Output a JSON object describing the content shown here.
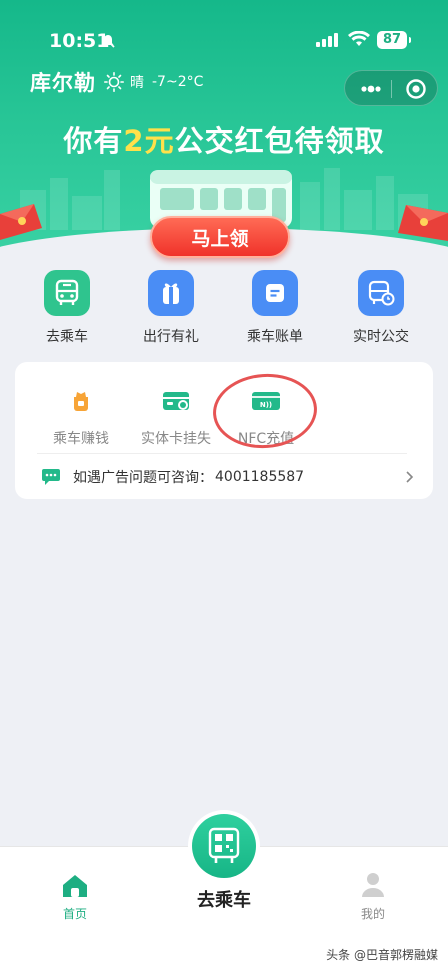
{
  "status_bar": {
    "time": "10:51",
    "battery": "87"
  },
  "weather": {
    "city": "库尔勒",
    "condition": "晴",
    "temperature": "-7~2°C"
  },
  "promo": {
    "prefix": "你有",
    "amount": "2元",
    "suffix": "公交红包待领取",
    "button": "马上领"
  },
  "quick_nav": [
    {
      "label": "去乘车",
      "icon": "bus-front-icon",
      "color": "#2fc48e"
    },
    {
      "label": "出行有礼",
      "icon": "gift-icon",
      "color": "#4a8df5"
    },
    {
      "label": "乘车账单",
      "icon": "bill-icon",
      "color": "#4a8df5"
    },
    {
      "label": "实时公交",
      "icon": "realtime-bus-icon",
      "color": "#4a8df5"
    }
  ],
  "services": [
    {
      "label": "乘车赚钱",
      "icon": "money-bag-icon"
    },
    {
      "label": "实体卡挂失",
      "icon": "card-lost-icon"
    },
    {
      "label": "NFC充值",
      "icon": "nfc-card-icon"
    }
  ],
  "ad": {
    "text": "如遇广告问题可咨询：",
    "phone": "4001185587"
  },
  "bottom_nav": {
    "home": "首页",
    "center": "去乘车",
    "mine": "我的"
  },
  "watermark": "头条 @巴音郭楞融媒",
  "colors": {
    "brand": "#1eae82",
    "accent_red": "#f0322a"
  }
}
